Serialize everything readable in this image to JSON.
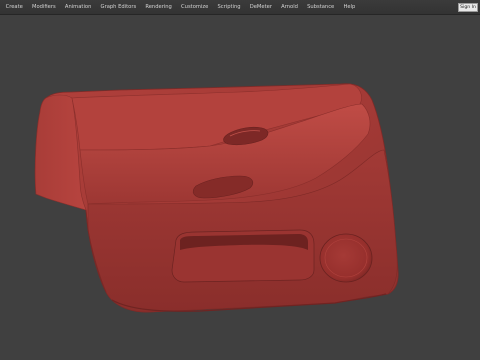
{
  "menubar": {
    "items": [
      {
        "label": "Create"
      },
      {
        "label": "Modifiers"
      },
      {
        "label": "Animation"
      },
      {
        "label": "Graph Editors"
      },
      {
        "label": "Rendering"
      },
      {
        "label": "Customize"
      },
      {
        "label": "Scripting"
      },
      {
        "label": "DeMeter"
      },
      {
        "label": "Arnold"
      },
      {
        "label": "Substance"
      },
      {
        "label": "Help"
      }
    ],
    "signin_label": "Sign In"
  },
  "viewport": {
    "background_color": "#404040",
    "model_color": "#a33a36",
    "model": "car-door-panel"
  }
}
